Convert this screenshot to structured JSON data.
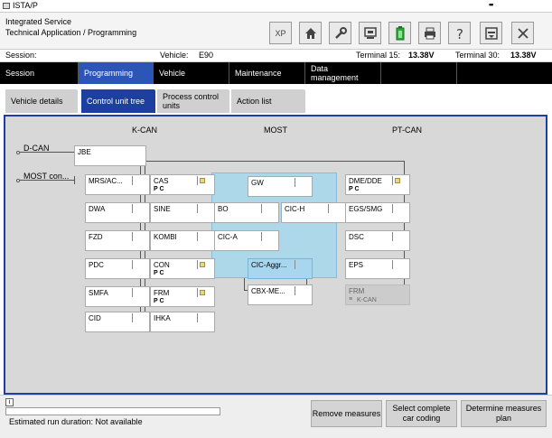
{
  "window": {
    "title": "ISTA/P",
    "dots": "••"
  },
  "header": {
    "line1": "Integrated Service",
    "line2": "Technical Application / Programming",
    "toolbar": {
      "xp": "XP"
    }
  },
  "session": {
    "session_label": "Session:",
    "vehicle_label": "Vehicle:",
    "vehicle_value": "E90",
    "t15_label": "Terminal 15:",
    "t15_value": "13.38V",
    "t30_label": "Terminal 30:",
    "t30_value": "13.38V"
  },
  "menu": {
    "session": "Session",
    "programming": "Programming",
    "vehicle": "Vehicle",
    "maintenance": "Maintenance",
    "data_mgmt": "Data management"
  },
  "subtabs": {
    "vehicle_details": "Vehicle details",
    "control_unit_tree": "Control unit tree",
    "process_units": "Process control units",
    "action_list": "Action list"
  },
  "tree": {
    "buses": {
      "kcan": "K-CAN",
      "most": "MOST",
      "ptcan": "PT-CAN"
    },
    "dcan": "D-CAN",
    "mostcon": "MOST con...",
    "ecus": {
      "jbe": "JBE",
      "mrs": "MRS/AC...",
      "dwa": "DWA",
      "fzd": "FZD",
      "pdc": "PDC",
      "smfa": "SMFA",
      "cid": "CID",
      "cas": "CAS",
      "sine": "SINE",
      "kombi": "KOMBI",
      "con": "CON",
      "frm": "FRM",
      "ihka": "IHKA",
      "gw": "GW",
      "bo": "BO",
      "cich": "CIC-H",
      "cica": "CIC-A",
      "cicaggr": "CIC-Aggr...",
      "cbxme": "CBX-ME...",
      "dmedde": "DME/DDE",
      "egssmg": "EGS/SMG",
      "dsc": "DSC",
      "eps": "EPS",
      "frm2": "FRM",
      "frm2_sub": "K-CAN"
    },
    "pc": "P C"
  },
  "bottom": {
    "info": "i",
    "estimated": "Estimated run duration: Not available",
    "remove": "Remove measures",
    "select_coding": "Select complete car coding",
    "determine": "Determine measures plan"
  }
}
